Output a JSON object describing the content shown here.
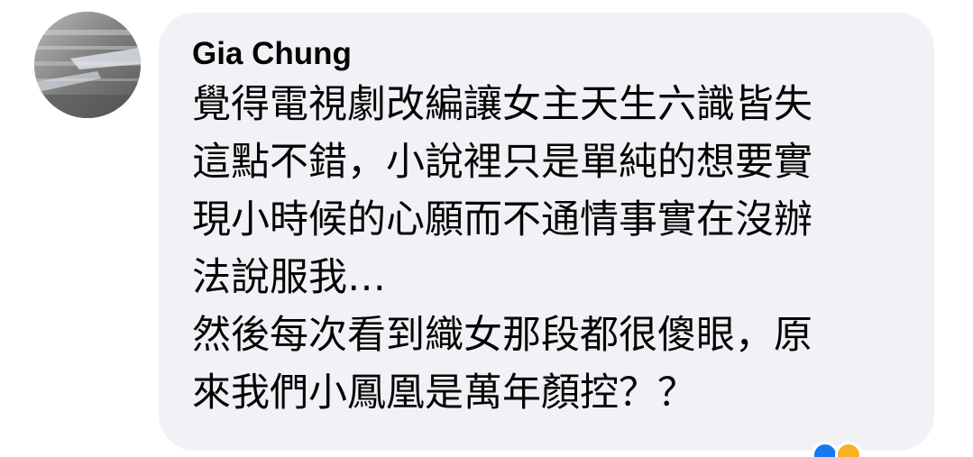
{
  "comment": {
    "author": "Gia Chung",
    "lines": [
      "覺得電視劇改編讓女主天生六識皆失",
      "這點不錯，小說裡只是單純的想要實",
      "現小時候的心願而不通情事實在沒辦",
      "法說服我…",
      "然後每次看到織女那段都很傻眼，原",
      "來我們小鳳凰是萬年顏控？？"
    ]
  },
  "reactions": {
    "icons": [
      "like-icon",
      "haha-icon"
    ]
  },
  "colors": {
    "bubble_bg": "#f0f2f5",
    "text": "#050505",
    "like_blue": "#1877f2",
    "haha_yellow": "#f7b125"
  }
}
